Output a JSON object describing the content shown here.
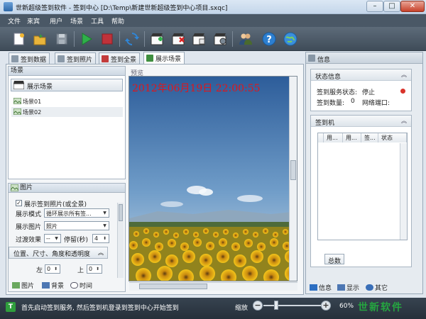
{
  "window": {
    "title": "世新超级签到软件 - 签到中心 [D:\\Temp\\新建世新超级签到中心项目.sxqc]",
    "minimize": "–",
    "maximize": "□",
    "close": "✕"
  },
  "menu": [
    "文件",
    "来宾",
    "用户",
    "场景",
    "工具",
    "帮助"
  ],
  "toolbar": {
    "icons": [
      "new-project-icon",
      "open-project-icon",
      "save-icon",
      "start-icon",
      "stop-icon",
      "refresh-icon",
      "add-scene-icon",
      "delete-scene-icon",
      "scene-ab-icon",
      "scene-settings-icon",
      "users-icon",
      "help-icon",
      "web-icon"
    ]
  },
  "tabs": [
    "签到数据",
    "签到照片",
    "签到全景",
    "展示场景"
  ],
  "scene_panel": {
    "header": "场景",
    "group": "展示场景",
    "items": [
      "场景01",
      "场景02"
    ]
  },
  "picture_panel": {
    "header": "图片",
    "show_photos_label": "展示签到照片(或全景)",
    "show_photos_checked": "✓",
    "display_mode_label": "展示模式",
    "display_mode_value": "循环展示所有签...",
    "display_image_label": "展示图片",
    "display_image_value": "照片",
    "transition_label": "过渡效果",
    "transition_value": "--",
    "pause_label": "停留(秒)",
    "pause_value": "4",
    "section_label": "位置、尺寸、角度和透明度",
    "section_chevron": "︽",
    "left_label": "左",
    "left_value": "0",
    "top_label": "上",
    "top_value": "0",
    "bottom_tabs": [
      "图片",
      "背景",
      "时间"
    ]
  },
  "preview": {
    "label": "预览",
    "datetime": "2012年06月19日  22:00:55"
  },
  "info_panel": {
    "header": "信息",
    "status_box": {
      "title": "状态信息",
      "collapse": "︽",
      "service_label": "签到服务状态:",
      "service_value": "停止",
      "count_label": "签到数量:",
      "count_value": "0",
      "port_label": "网络端口:",
      "port_value": ""
    },
    "device_box": {
      "title": "签到机",
      "collapse": "︽",
      "columns": [
        "用...",
        "用...",
        "签...",
        "状态"
      ],
      "total_label": "总数"
    },
    "bottom_tabs": [
      "信息",
      "显示",
      "其它"
    ]
  },
  "statusbar": {
    "icon_letter": "T",
    "message": "首先启动签到服务, 然后签到机登录到签到中心开始签到",
    "zoom_label": "缩放",
    "zoom_minus": "−",
    "zoom_plus": "+",
    "zoom_value": "60%",
    "brand": "世新软件"
  },
  "colors": {
    "menubar": "#4a5866",
    "toolbar": "#47535f",
    "datetime": "#e0161b",
    "brand": "#25a640",
    "status_dot": "#d9342b"
  }
}
